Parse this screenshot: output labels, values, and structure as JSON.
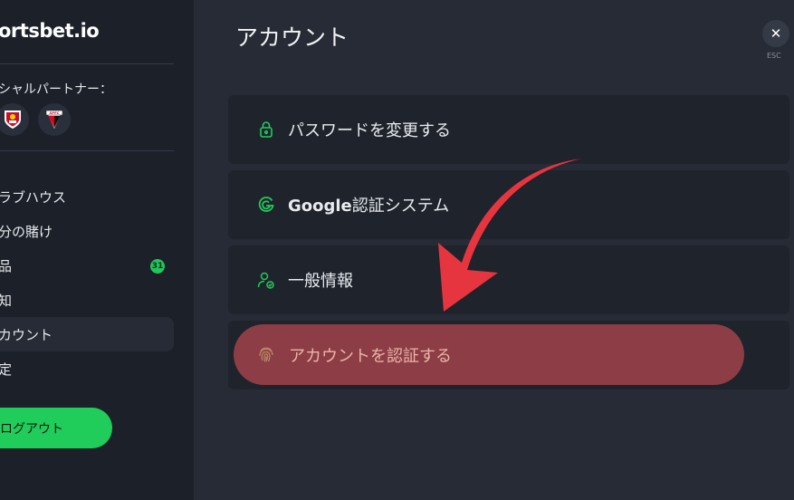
{
  "sidebar": {
    "logo": "ortsbet.io",
    "partners_label": "シャルパートナー：",
    "partner_icons": [
      "southampton-crest-icon",
      "sao-paulo-crest-icon"
    ],
    "items": [
      {
        "label": "ラブハウス"
      },
      {
        "label": "分の賭け"
      },
      {
        "label": "品",
        "badge": "31"
      },
      {
        "label": "知"
      },
      {
        "label": "カウント",
        "active": true
      },
      {
        "label": "定"
      }
    ],
    "logout_label": "ログアウト"
  },
  "main": {
    "title": "アカウント",
    "close_label": "✕",
    "esc_label": "ESC",
    "rows": [
      {
        "label": "パスワードを変更する",
        "icon": "lock-icon"
      },
      {
        "label_bold": "Google",
        "label_rest": "認証システム",
        "icon": "google-icon"
      },
      {
        "label": "一般情報",
        "icon": "user-check-icon"
      },
      {
        "label": "アカウントを認証する",
        "icon": "fingerprint-icon"
      }
    ]
  },
  "colors": {
    "accent_green": "#20cc5a",
    "highlight_red": "#e6353f",
    "pill_red": "#8d3d45"
  }
}
